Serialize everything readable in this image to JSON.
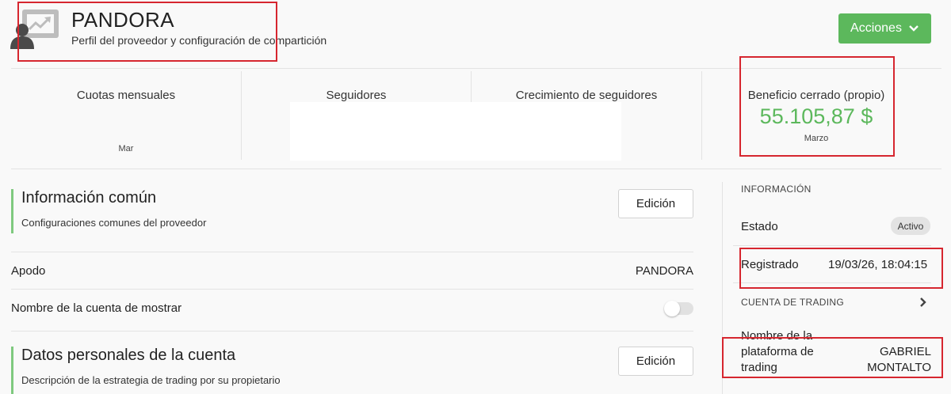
{
  "header": {
    "title": "PANDORA",
    "subtitle": "Perfil del proveedor y configuración de compartición",
    "actions_label": "Acciones"
  },
  "stats": [
    {
      "label": "Cuotas mensuales",
      "sub": "Mar"
    },
    {
      "label": "Seguidores"
    },
    {
      "label": "Crecimiento de seguidores"
    },
    {
      "label": "Beneficio cerrado (propio)",
      "value": "55.105,87 $",
      "sub": "Marzo"
    }
  ],
  "common_info": {
    "title": "Información común",
    "description": "Configuraciones comunes del proveedor",
    "edit_label": "Edición",
    "rows": [
      {
        "label": "Apodo",
        "value": "PANDORA"
      },
      {
        "label": "Nombre de la cuenta de mostrar",
        "toggle": false
      }
    ]
  },
  "personal_data": {
    "title": "Datos personales de la cuenta",
    "description": "Descripción de la estrategia de trading por su propietario",
    "edit_label": "Edición"
  },
  "info_panel": {
    "heading": "INFORMACIÓN",
    "status_label": "Estado",
    "status_value": "Activo",
    "registered_label": "Registrado",
    "registered_value": "19/03/26, 18:04:15",
    "trading_heading": "CUENTA DE TRADING",
    "platform_label_1": "Nombre de la",
    "platform_label_2": "plataforma de",
    "platform_label_3": "trading",
    "platform_value_1": "GABRIEL",
    "platform_value_2": "MONTALTO"
  },
  "colors": {
    "accent": "#5cb85c",
    "highlight": "#d6262f"
  }
}
